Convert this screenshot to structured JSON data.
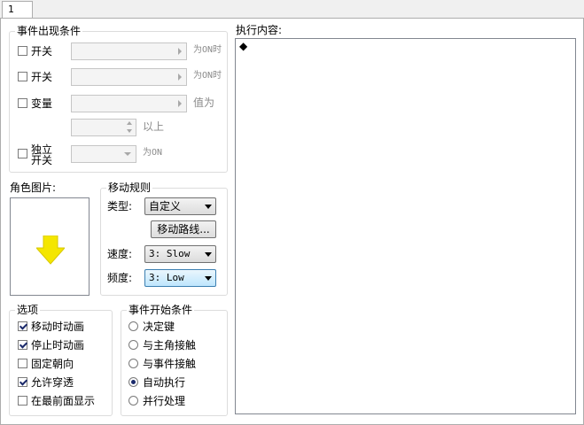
{
  "tab": {
    "label": "1"
  },
  "conditions": {
    "title": "事件出现条件",
    "switch1": {
      "label": "开关",
      "suffix": "为ON时"
    },
    "switch2": {
      "label": "开关",
      "suffix": "为ON时"
    },
    "variable": {
      "label": "变量",
      "suffix": "值为",
      "above": "以上"
    },
    "self_switch": {
      "label_line1": "独立",
      "label_line2": "开关",
      "suffix": "为ON"
    }
  },
  "graphic": {
    "title": "角色图片:",
    "arrow_color": "#f4e600"
  },
  "movement": {
    "title": "移动规则",
    "type_label": "类型:",
    "type_value": "自定义",
    "route_button": "移动路线...",
    "speed_label": "速度:",
    "speed_value": "3: Slow",
    "freq_label": "频度:",
    "freq_value": "3: Low"
  },
  "options": {
    "title": "选项",
    "items": [
      {
        "label": "移动时动画",
        "checked": true
      },
      {
        "label": "停止时动画",
        "checked": true
      },
      {
        "label": "固定朝向",
        "checked": false
      },
      {
        "label": "允许穿透",
        "checked": true
      },
      {
        "label": "在最前面显示",
        "checked": false
      }
    ]
  },
  "trigger": {
    "title": "事件开始条件",
    "items": [
      {
        "label": "决定键",
        "checked": false
      },
      {
        "label": "与主角接触",
        "checked": false
      },
      {
        "label": "与事件接触",
        "checked": false
      },
      {
        "label": "自动执行",
        "checked": true
      },
      {
        "label": "并行处理",
        "checked": false
      }
    ]
  },
  "contents": {
    "title": "执行内容:",
    "first_line": "◆"
  }
}
